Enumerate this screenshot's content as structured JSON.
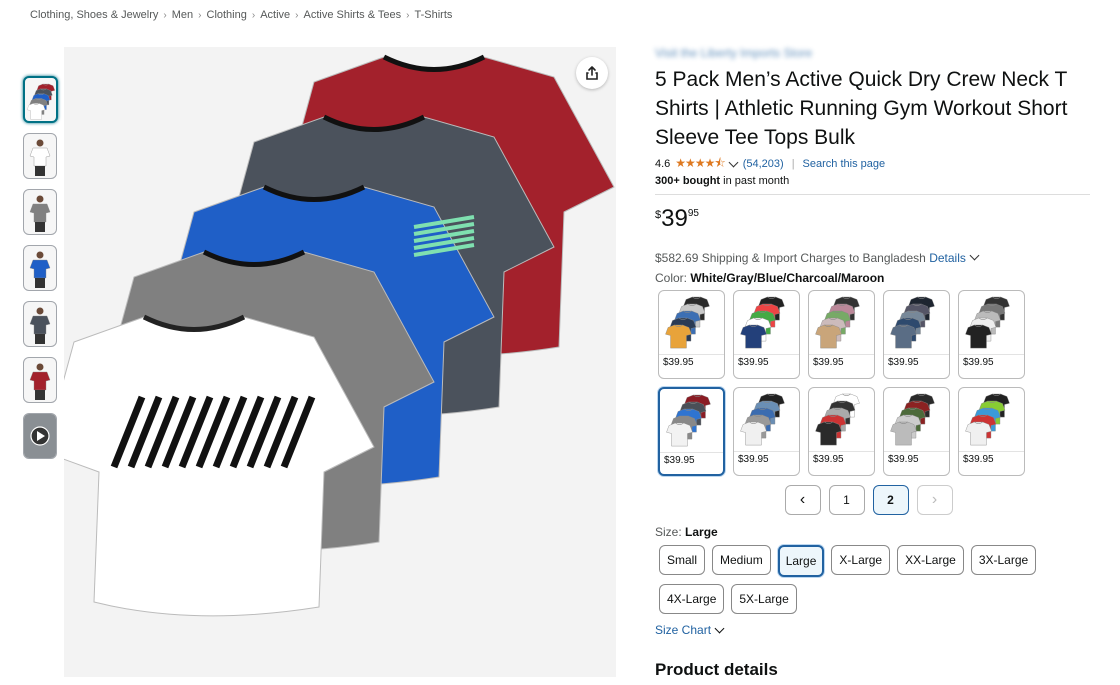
{
  "breadcrumb": [
    "Clothing, Shoes & Jewelry",
    "Men",
    "Clothing",
    "Active",
    "Active Shirts & Tees",
    "T-Shirts"
  ],
  "product": {
    "store_link": "Visit the Liberty Imports Store",
    "title": "5 Pack Men’s Active Quick Dry Crew Neck T Shirts | Athletic Running Gym Workout Short Sleeve Tee Tops Bulk",
    "rating": "4.6",
    "stars": "★★★★⯪",
    "reviews": "(54,203)",
    "search_link": "Search this page",
    "bought_bold": "300+ bought",
    "bought_rest": " in past month",
    "price_currency": "$",
    "price_whole": "39",
    "price_fraction": "95",
    "shipping_text": "$582.69 Shipping & Import Charges to Bangladesh ",
    "shipping_link": "Details",
    "color_label": "Color: ",
    "color_value": "White/Gray/Blue/Charcoal/Maroon",
    "size_label": "Size: ",
    "size_value": "Large",
    "size_chart": "Size Chart",
    "details_heading": "Product details"
  },
  "swatches": [
    {
      "price": "$39.95",
      "colors": [
        "#2b2b2b",
        "#c9c9c9",
        "#3c6fb4",
        "#2a3b55",
        "#e8a33a"
      ]
    },
    {
      "price": "$39.95",
      "colors": [
        "#222",
        "#e44",
        "#4a4",
        "#fff",
        "#23407a"
      ]
    },
    {
      "price": "$39.95",
      "colors": [
        "#333",
        "#b89",
        "#7a6",
        "#cbb",
        "#c9a57a"
      ]
    },
    {
      "price": "$39.95",
      "colors": [
        "#1e2530",
        "#556",
        "#789",
        "#2e4a6e",
        "#5a6d85"
      ]
    },
    {
      "price": "$39.95",
      "colors": [
        "#333",
        "#777",
        "#bbb",
        "#eee",
        "#222"
      ]
    },
    {
      "price": "$39.95",
      "colors": [
        "#8b1c24",
        "#4a4f57",
        "#2f74d0",
        "#888",
        "#f2f2f2"
      ]
    },
    {
      "price": "$39.95",
      "colors": [
        "#222",
        "#6a8fb5",
        "#3b6cb0",
        "#999",
        "#f0f0f0"
      ]
    },
    {
      "price": "$39.95",
      "colors": [
        "#fff",
        "#333",
        "#aaa",
        "#c33",
        "#2a2a2a"
      ]
    },
    {
      "price": "$39.95",
      "colors": [
        "#2a2a2a",
        "#8b2222",
        "#4c6a3a",
        "#ccc",
        "#bbbbbb"
      ]
    },
    {
      "price": "$39.95",
      "colors": [
        "#222",
        "#8c3",
        "#3a9ad9",
        "#c33",
        "#f0f0f0"
      ]
    }
  ],
  "selected_swatch": 5,
  "pager": {
    "prev": "‹",
    "pages": [
      "1",
      "2"
    ],
    "current": "2",
    "next": "›"
  },
  "sizes": [
    "Small",
    "Medium",
    "Large",
    "X-Large",
    "XX-Large",
    "3X-Large",
    "4X-Large",
    "5X-Large"
  ],
  "selected_size": "Large",
  "main_image": {
    "shirt_colors": [
      "#a3212c",
      "#4b525c",
      "#1f5fc7",
      "#808080",
      "#ffffff"
    ],
    "accent": "#7fe0b0"
  },
  "colors": {
    "link": "#2162a1",
    "star": "#de7921",
    "selected": "#2162a1"
  }
}
